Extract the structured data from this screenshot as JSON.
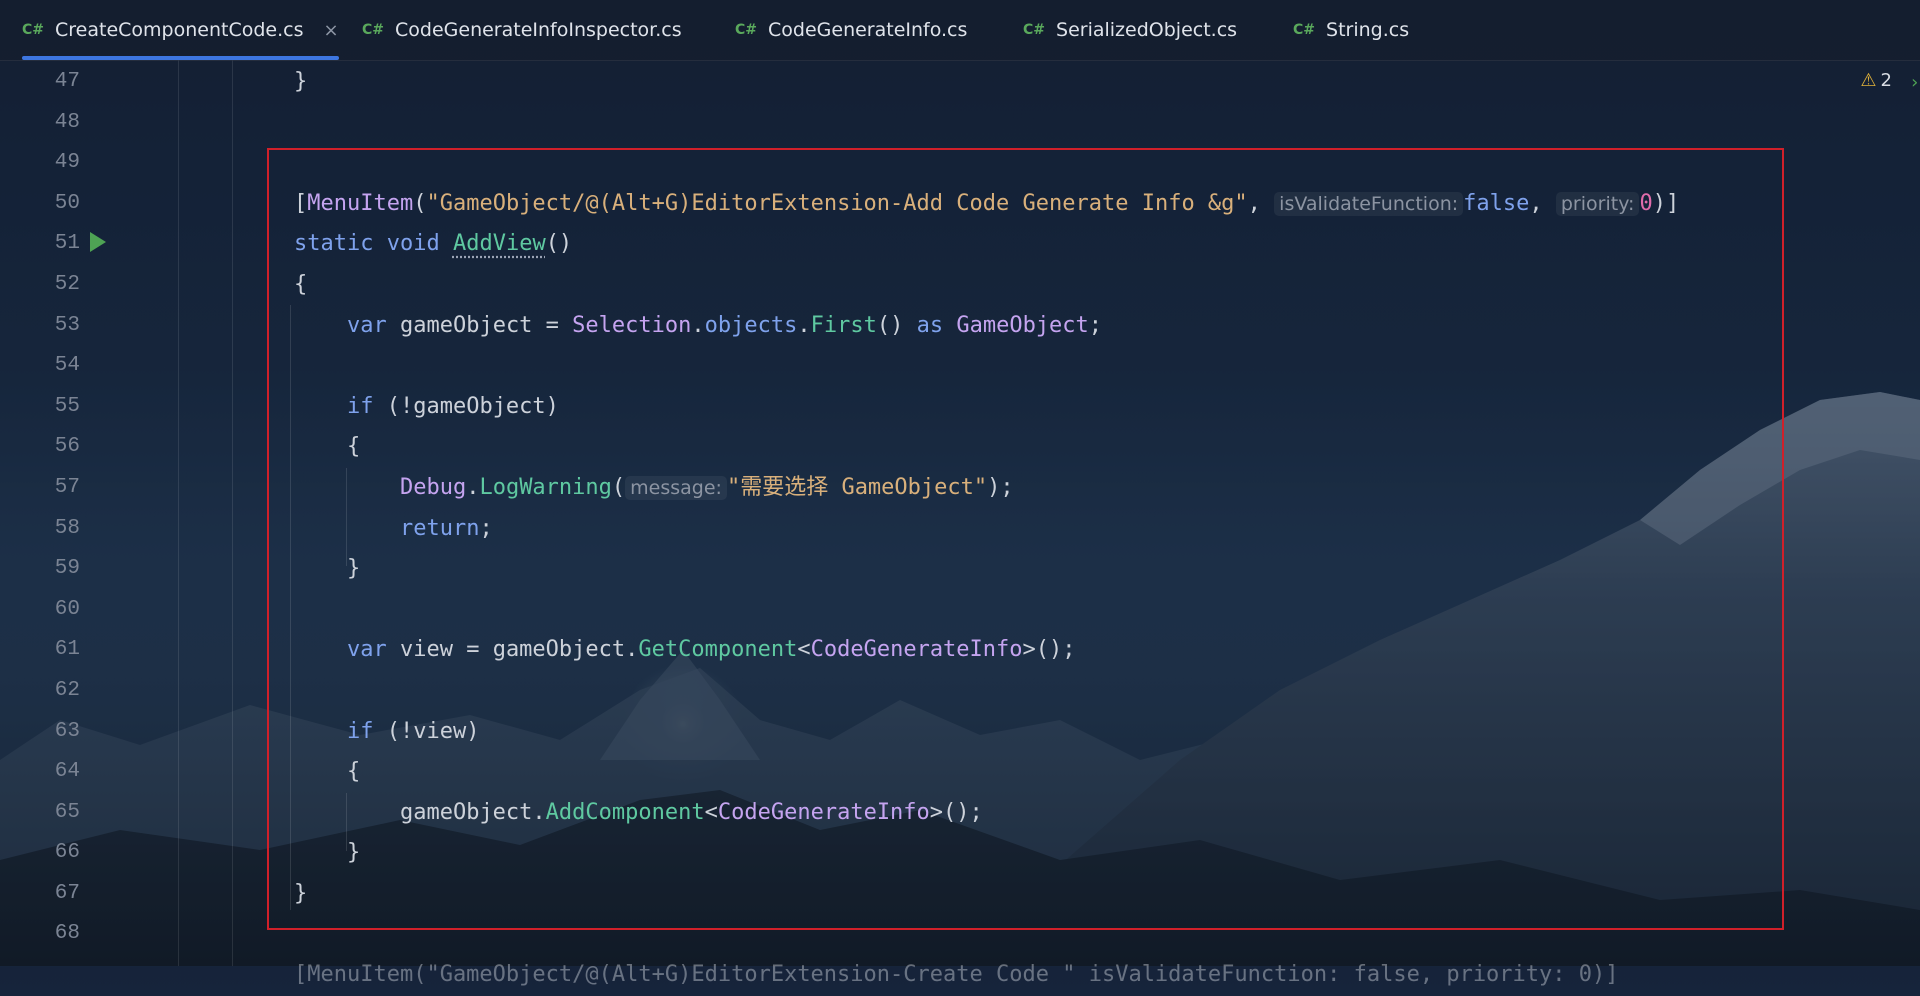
{
  "tabs": [
    {
      "lang": "C#",
      "label": "CreateComponentCode.cs",
      "active": true,
      "close": "×"
    },
    {
      "lang": "C#",
      "label": "CodeGenerateInfoInspector.cs"
    },
    {
      "lang": "C#",
      "label": "CodeGenerateInfo.cs"
    },
    {
      "lang": "C#",
      "label": "SerializedObject.cs"
    },
    {
      "lang": "C#",
      "label": "String.cs"
    }
  ],
  "line_numbers": [
    "47",
    "48",
    "49",
    "50",
    "51",
    "52",
    "53",
    "54",
    "55",
    "56",
    "57",
    "58",
    "59",
    "60",
    "61",
    "62",
    "63",
    "64",
    "65",
    "66",
    "67",
    "68"
  ],
  "inspection": {
    "icon": "warning-triangle-icon",
    "count": "2"
  },
  "code": {
    "l47": "}",
    "l50": {
      "open": "[",
      "attr": "MenuItem",
      "paren": "(",
      "path": "\"GameObject/@(Alt+G)EditorExtension-Add Code Generate Info &g\"",
      "comma1": ", ",
      "hint1": "isValidateFunction:",
      "false": "false",
      "comma2": ", ",
      "hint2": "priority:",
      "zero": "0",
      "close": ")]"
    },
    "l51": {
      "static": "static",
      "void": "void",
      "name": "AddView",
      "parens": "()"
    },
    "l52": "{",
    "l53": {
      "var": "var",
      "lhs": " gameObject = ",
      "cls": "Selection",
      "dot1": ".",
      "prop": "objects",
      "dot2": ".",
      "meth": "First",
      "parens": "() ",
      "as": "as",
      "type": "GameObject",
      "semi": ";"
    },
    "l55": {
      "if": "if",
      "cond": " (!gameObject)"
    },
    "l56": "{",
    "l57": {
      "cls": "Debug",
      "dot": ".",
      "meth": "LogWarning",
      "paren": "(",
      "hint": "message:",
      "str": "\"需要选择 GameObject\"",
      "close": ");"
    },
    "l58": {
      "ret": "return",
      "semi": ";"
    },
    "l59": "}",
    "l61": {
      "var": "var",
      "lhs": " view = gameObject.",
      "meth": "GetComponent",
      "lt": "<",
      "type": "CodeGenerateInfo",
      "tail": ">();"
    },
    "l63": {
      "if": "if",
      "cond": " (!view)"
    },
    "l64": "{",
    "l65": {
      "obj": "gameObject.",
      "meth": "AddComponent",
      "lt": "<",
      "type": "CodeGenerateInfo",
      "tail": ">();"
    },
    "l66": "}",
    "l67": "}",
    "l69_partial": "[MenuItem(\"GameObject/@(Alt+G)EditorExtension-Create Code \" isValidateFunction: false, priority: 0)]"
  },
  "colors": {
    "accent": "#3d76e0",
    "highlight_border": "#d0202a",
    "keyword": "#7fa2ec",
    "class": "#c5a4f0",
    "string": "#d9b07b",
    "method": "#5fc9a1",
    "number": "#e06cab"
  }
}
